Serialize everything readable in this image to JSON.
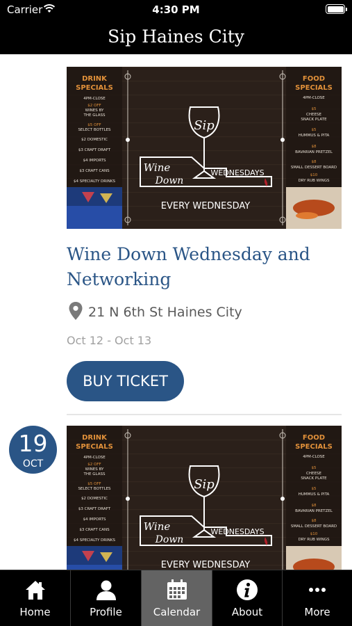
{
  "status_bar": {
    "carrier": "Carrier",
    "time": "4:30 PM"
  },
  "header": {
    "title": "Sip Haines City"
  },
  "poster": {
    "drink_heading": "DRINK\nSPECIALS",
    "drink_items": [
      "4PM-CLOSE",
      "$2 OFF",
      "WINES BY",
      "THE GLASS",
      "$5 OFF",
      "SELECT BOTTLES",
      "$2 DOMESTIC",
      "$3 CRAFT DRAFT",
      "$4 IMPORTS",
      "$3 CRAFT CANS",
      "$4 SPECIALTY DRINKS"
    ],
    "food_heading": "FOOD\nSPECIALS",
    "food_items": [
      "4PM-CLOSE",
      "$5",
      "CHEESE",
      "SNACK PLATE",
      "$5",
      "HUMMUS & PITA",
      "$8",
      "BAVARIAN PRETZEL",
      "$8",
      "SMALL DESSERT BOARD",
      "$10",
      "DRY RUB WINGS"
    ],
    "logo_script": "Sip",
    "wine_down": "Wine\nDown",
    "wednesdays": "WEDNESDAYS",
    "every": "EVERY WEDNESDAY"
  },
  "events": [
    {
      "title": "Wine Down Wednesday and Networking",
      "location": "21 N 6th St Haines City",
      "dates": "Oct 12 - Oct 13",
      "button": "BUY TICKET"
    },
    {
      "badge_day": "19",
      "badge_month": "OCT"
    }
  ],
  "tabs": [
    {
      "label": "Home",
      "icon": "home-icon"
    },
    {
      "label": "Profile",
      "icon": "profile-icon"
    },
    {
      "label": "Calendar",
      "icon": "calendar-icon",
      "active": true
    },
    {
      "label": "About",
      "icon": "info-icon"
    },
    {
      "label": "More",
      "icon": "more-icon"
    }
  ],
  "colors": {
    "accent": "#2a5586",
    "poster_orange": "#e2913a",
    "tab_active": "#636363"
  }
}
